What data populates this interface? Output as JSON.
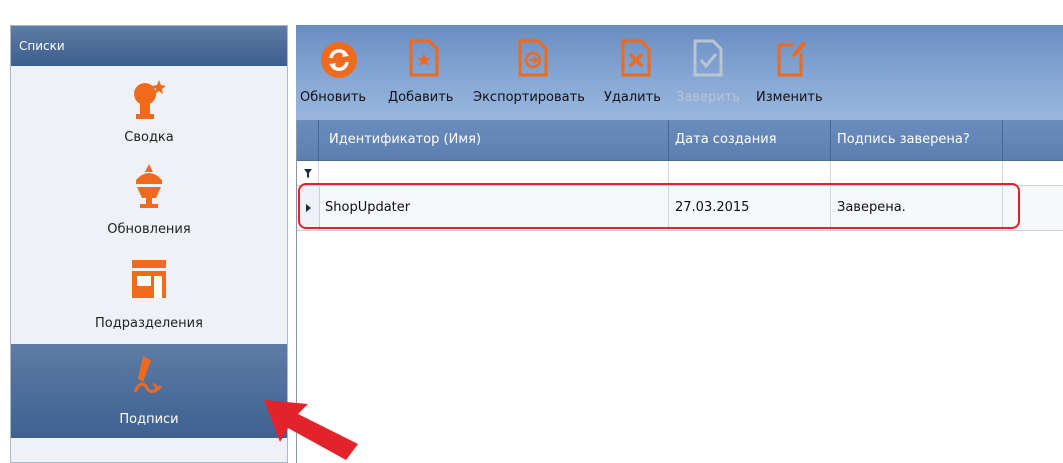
{
  "nav": {
    "header": "Списки",
    "items": [
      {
        "label": "Сводка",
        "icon": "summary-icon"
      },
      {
        "label": "Обновления",
        "icon": "updates-icon"
      },
      {
        "label": "Подразделения",
        "icon": "store-icon"
      },
      {
        "label": "Подписи",
        "icon": "signature-icon",
        "active": true
      }
    ]
  },
  "toolbar": {
    "buttons": [
      {
        "label": "Обновить",
        "icon": "refresh-icon",
        "enabled": true
      },
      {
        "label": "Добавить",
        "icon": "add-document-icon",
        "enabled": true
      },
      {
        "label": "Экспортировать",
        "icon": "export-document-icon",
        "enabled": true
      },
      {
        "label": "Удалить",
        "icon": "delete-document-icon",
        "enabled": true
      },
      {
        "label": "Заверить",
        "icon": "certify-document-icon",
        "enabled": false
      },
      {
        "label": "Изменить",
        "icon": "edit-document-icon",
        "enabled": true
      }
    ]
  },
  "grid": {
    "columns": [
      "Идентификатор (Имя)",
      "Дата создания",
      "Подпись заверена?"
    ],
    "rows": [
      {
        "name": "ShopUpdater",
        "created": "27.03.2015",
        "certified": "Заверена."
      }
    ]
  },
  "colors": {
    "accent": "#f06a1d",
    "header": "#4a6b98",
    "highlight": "#e2232b"
  }
}
